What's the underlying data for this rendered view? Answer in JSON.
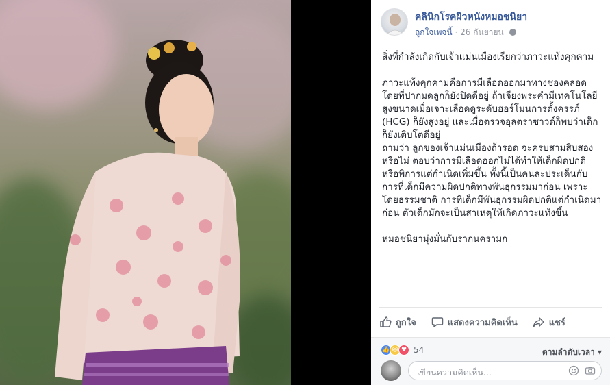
{
  "post": {
    "page_name": "คลินิกโรคผิวหนังหมอชนิยา",
    "liked_label": "ถูกใจเพจนี้",
    "separator": " · ",
    "date": "26 กันยายน",
    "body": "สิ่งที่กำลังเกิดกับเจ้าแม่นเมืองเรียกว่าภาวะแท้งคุกคาม\n\nภาวะแท้งคุกคามคือการมีเลือดออกมาทางช่องคลอด โดยที่ปากมดลูกก็ยังปิดดีอยู่ ถ้าเจียงพระคำมีเทคโนโลยีสูงขนาดเมื่อเจาะเลือดดูระดับฮอร์โมนการตั้งครรภ์ (HCG) ก็ยังสูงอยู่ และเมื่อตรวจอุลตราซาวด์ก็พบว่าเด็กก็ยังเติบโตดีอยู่\nถามว่า ลูกของเจ้าแม่นเมืองถ้ารอด จะครบสามสิบสองหรือไม่ ตอบว่าการมีเลือดออกไม่ได้ทำให้เด็กผิดปกติหรือพิการแต่กำเนิดเพิ่มขึ้น ทั้งนี้เป็นคนละประเด็นกับการที่เด็กมีความผิดปกติทางพันธุกรรมมาก่อน เพราะโดยธรรมชาติ การที่เด็กมีพันธุกรรมผิดปกติแต่กำเนิดมาก่อน ตัวเด็กมักจะเป็นสาเหตุให้เกิดภาวะแท้งขึ้น\n\nหมอชนิยามุ่งมั่นกับรากนคราม​ก"
  },
  "actions": {
    "like": "ถูกใจ",
    "comment": "แสดงความคิดเห็น",
    "share": "แชร์"
  },
  "reactions": {
    "count": "54",
    "sort_label": "ตามลำดับเวลา ▾"
  },
  "comment_box": {
    "placeholder": "เขียนความคิดเห็น..."
  },
  "colors": {
    "link": "#365899",
    "meta": "#90949c",
    "action": "#606770"
  },
  "icons": [
    "globe-icon",
    "like-icon",
    "comment-icon",
    "share-icon",
    "emoji-icon",
    "camera-icon"
  ]
}
